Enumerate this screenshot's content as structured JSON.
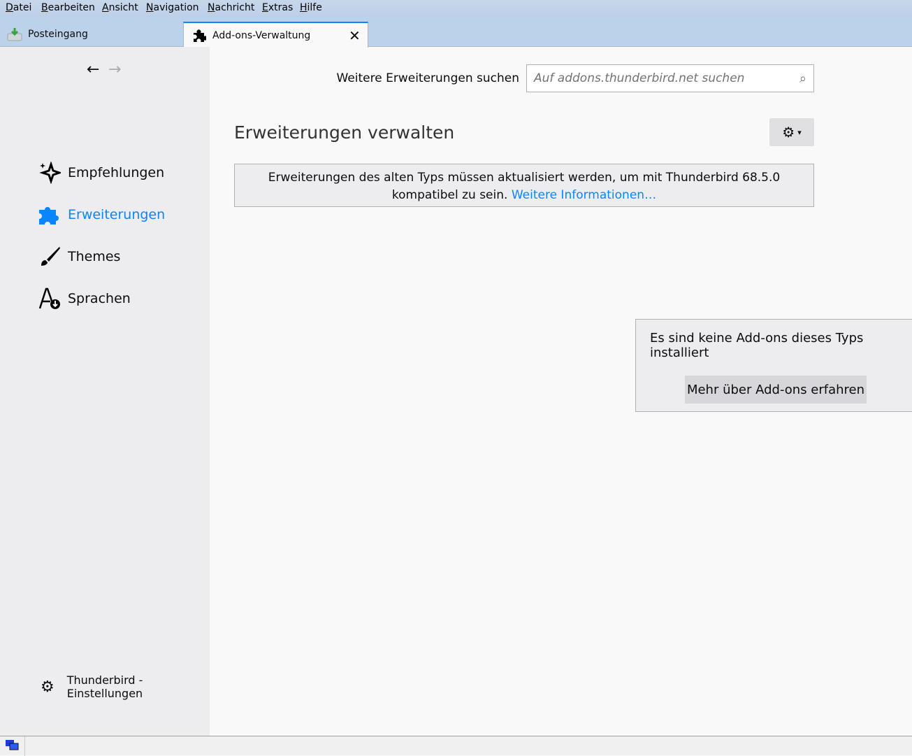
{
  "menu": [
    "Datei",
    "Bearbeiten",
    "Ansicht",
    "Navigation",
    "Nachricht",
    "Extras",
    "Hilfe"
  ],
  "tabs": {
    "inbox": "Posteingang",
    "addons": "Add-ons-Verwaltung"
  },
  "sidebar": {
    "items": [
      "Empfehlungen",
      "Erweiterungen",
      "Themes",
      "Sprachen"
    ],
    "settings_line1": "Thunderbird -",
    "settings_line2": "Einstellungen"
  },
  "search": {
    "label": "Weitere Erweiterungen suchen",
    "placeholder": "Auf addons.thunderbird.net suchen"
  },
  "main": {
    "title": "Erweiterungen verwalten",
    "notice": "Erweiterungen des alten Typs müssen aktualisiert werden, um mit Thunderbird 68.5.0 kompatibel zu sein.",
    "notice_link": "Weitere Informationen…",
    "empty_text": "Es sind keine Add-ons dieses Typs installiert",
    "empty_button": "Mehr über Add-ons erfahren"
  },
  "colors": {
    "accent": "#0a84ff"
  }
}
